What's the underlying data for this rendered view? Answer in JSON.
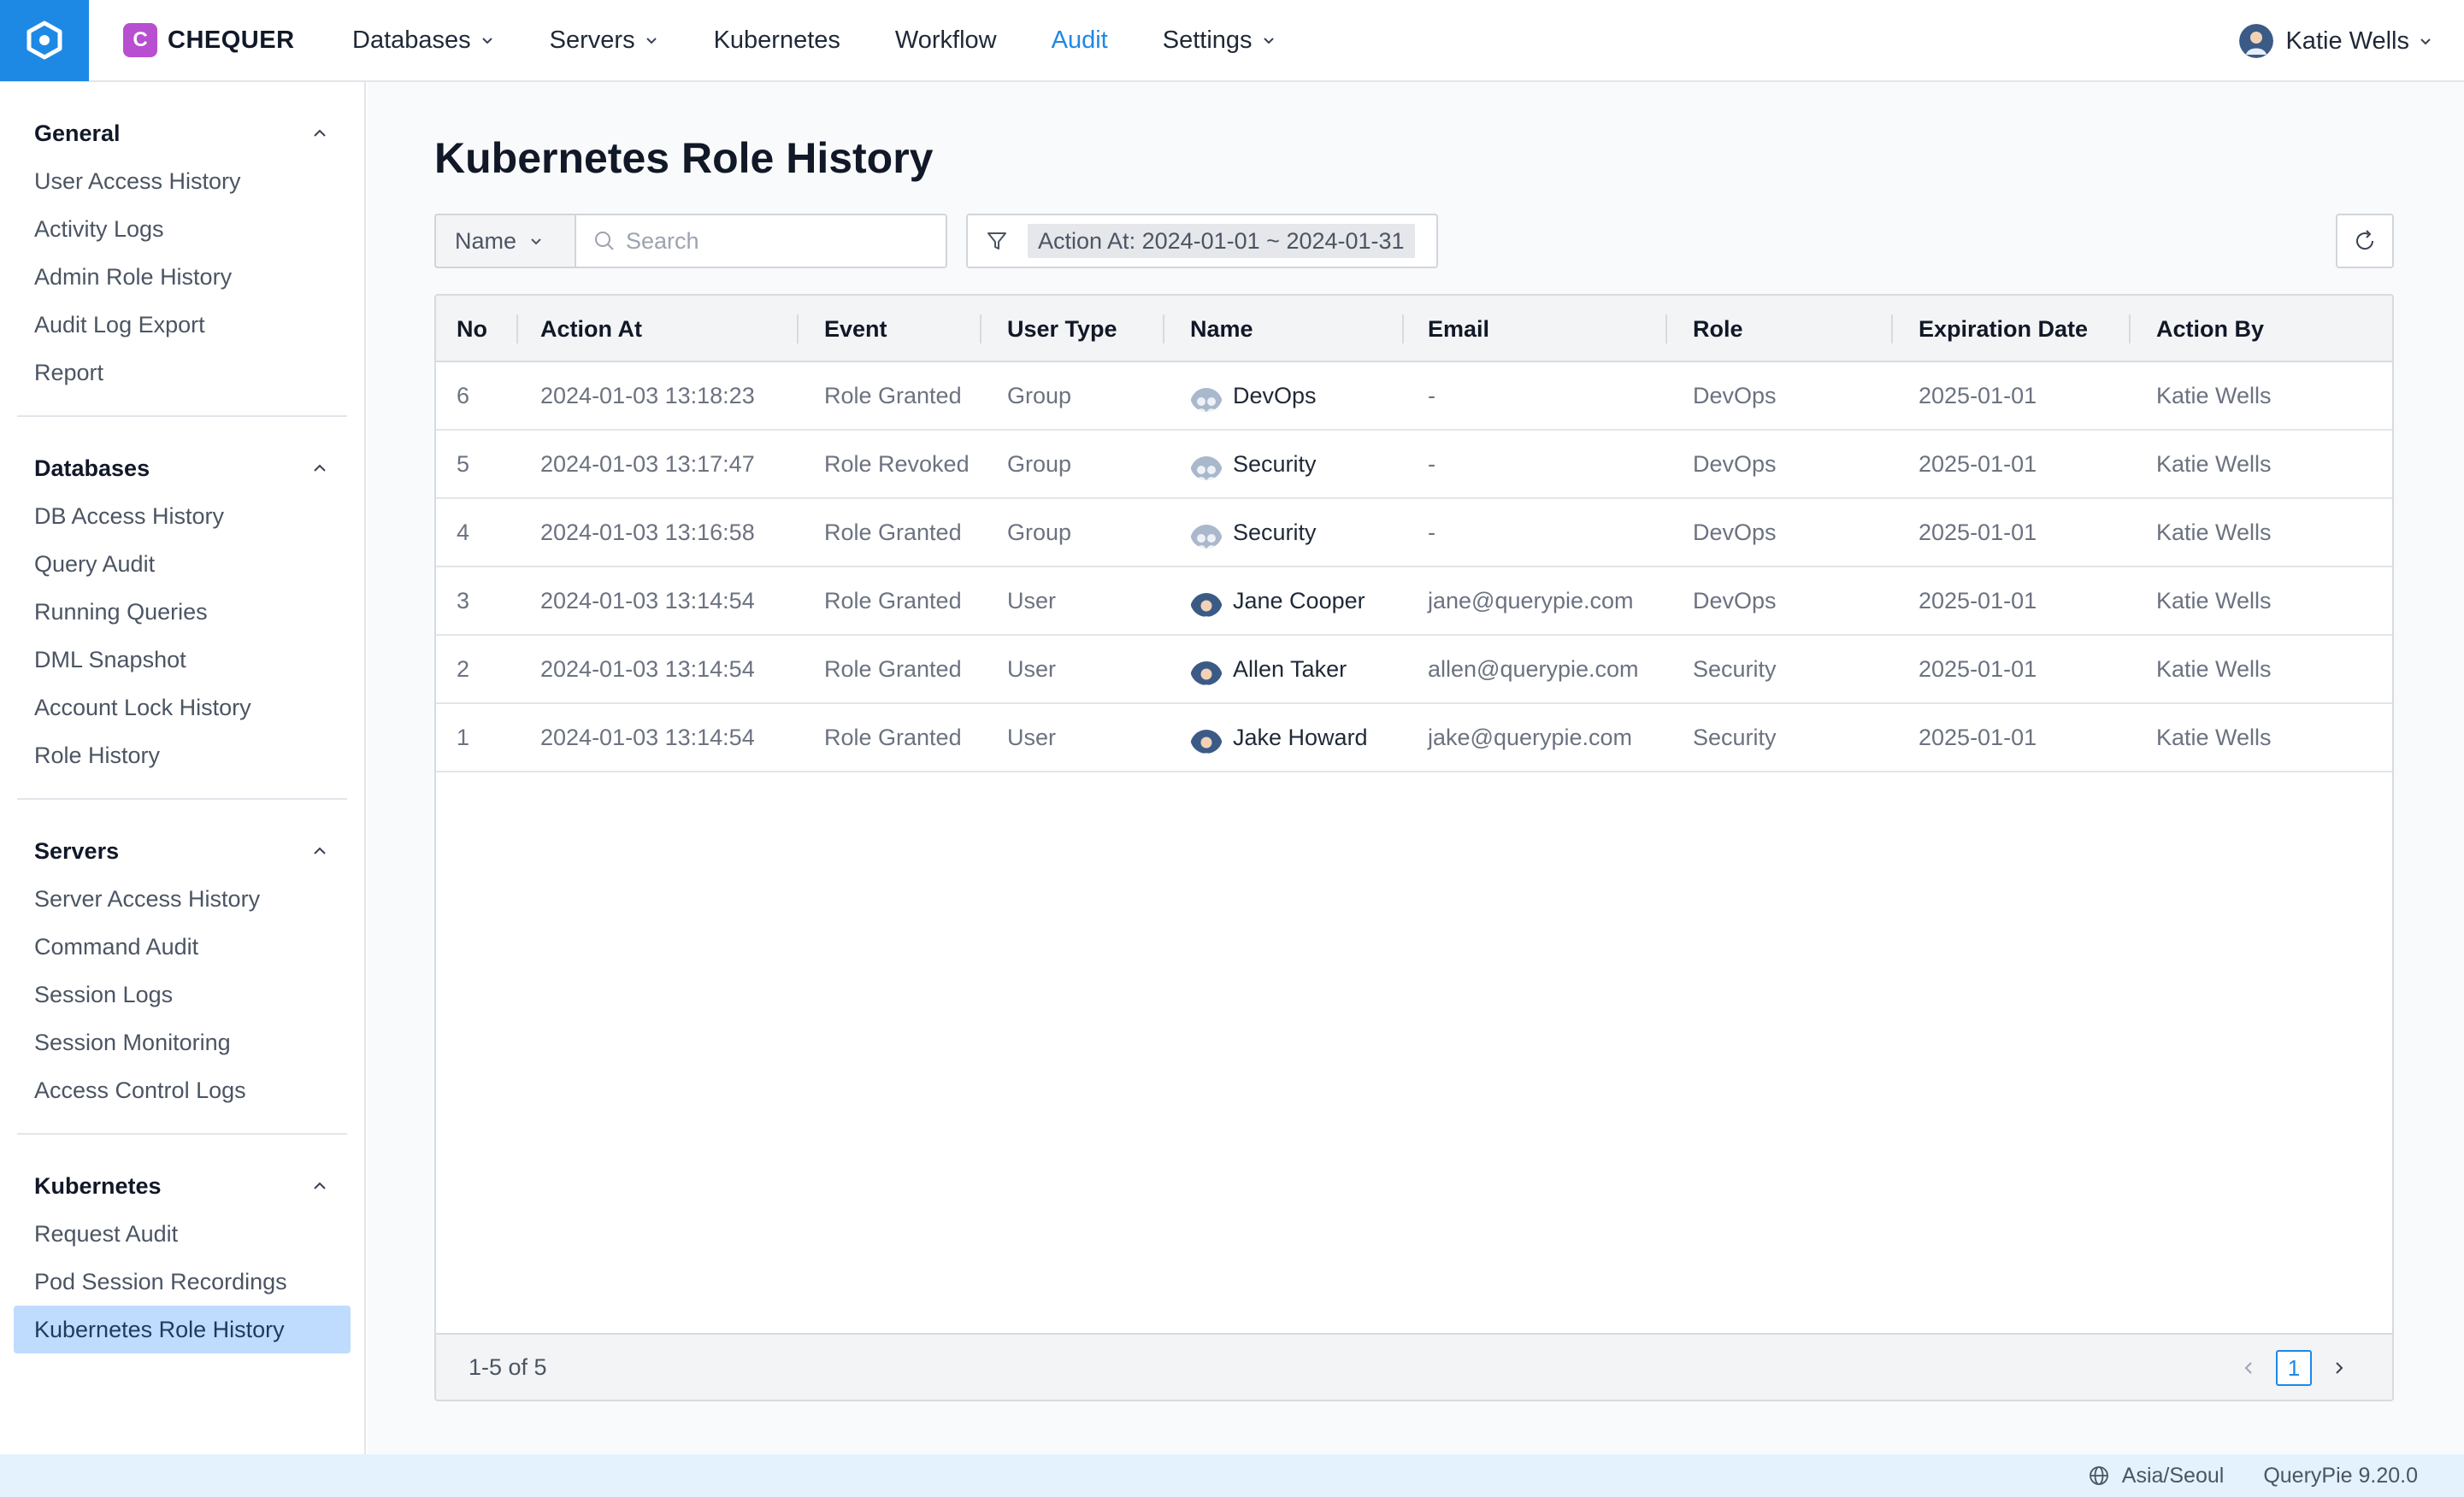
{
  "app": {
    "brand_letter": "C",
    "brand_name": "CHEQUER",
    "brand_color": "#b84fd0",
    "accent_color": "#1e88e5"
  },
  "nav": {
    "items": [
      {
        "label": "Databases",
        "has_dropdown": true,
        "active": false
      },
      {
        "label": "Servers",
        "has_dropdown": true,
        "active": false
      },
      {
        "label": "Kubernetes",
        "has_dropdown": false,
        "active": false
      },
      {
        "label": "Workflow",
        "has_dropdown": false,
        "active": false
      },
      {
        "label": "Audit",
        "has_dropdown": false,
        "active": true
      },
      {
        "label": "Settings",
        "has_dropdown": true,
        "active": false
      }
    ],
    "user_name": "Katie Wells"
  },
  "sidebar": {
    "sections": [
      {
        "title": "General",
        "items": [
          "User Access History",
          "Activity Logs",
          "Admin Role History",
          "Audit Log Export",
          "Report"
        ]
      },
      {
        "title": "Databases",
        "items": [
          "DB Access History",
          "Query Audit",
          "Running Queries",
          "DML Snapshot",
          "Account Lock History",
          "Role History"
        ]
      },
      {
        "title": "Servers",
        "items": [
          "Server Access History",
          "Command Audit",
          "Session Logs",
          "Session Monitoring",
          "Access Control Logs"
        ]
      },
      {
        "title": "Kubernetes",
        "items": [
          "Request Audit",
          "Pod Session Recordings",
          "Kubernetes Role History"
        ]
      }
    ],
    "active_item": "Kubernetes Role History"
  },
  "main": {
    "title": "Kubernetes Role History",
    "search_field": "Name",
    "search_placeholder": "Search",
    "filter_label": "Action At: 2024-01-01 ~ 2024-01-31"
  },
  "table": {
    "columns": [
      "No",
      "Action At",
      "Event",
      "User Type",
      "Name",
      "Email",
      "Role",
      "Expiration Date",
      "Action By"
    ],
    "rows": [
      {
        "no": "6",
        "action_at": "2024-01-03 13:18:23",
        "event": "Role Granted",
        "user_type": "Group",
        "name": "DevOps",
        "email": "-",
        "role": "DevOps",
        "expiration": "2025-01-01",
        "action_by": "Katie Wells"
      },
      {
        "no": "5",
        "action_at": "2024-01-03 13:17:47",
        "event": "Role Revoked",
        "user_type": "Group",
        "name": "Security",
        "email": "-",
        "role": "DevOps",
        "expiration": "2025-01-01",
        "action_by": "Katie Wells"
      },
      {
        "no": "4",
        "action_at": "2024-01-03 13:16:58",
        "event": "Role Granted",
        "user_type": "Group",
        "name": "Security",
        "email": "-",
        "role": "DevOps",
        "expiration": "2025-01-01",
        "action_by": "Katie Wells"
      },
      {
        "no": "3",
        "action_at": "2024-01-03 13:14:54",
        "event": "Role Granted",
        "user_type": "User",
        "name": "Jane Cooper",
        "email": "jane@querypie.com",
        "role": "DevOps",
        "expiration": "2025-01-01",
        "action_by": "Katie Wells"
      },
      {
        "no": "2",
        "action_at": "2024-01-03 13:14:54",
        "event": "Role Granted",
        "user_type": "User",
        "name": "Allen Taker",
        "email": "allen@querypie.com",
        "role": "Security",
        "expiration": "2025-01-01",
        "action_by": "Katie Wells"
      },
      {
        "no": "1",
        "action_at": "2024-01-03 13:14:54",
        "event": "Role Granted",
        "user_type": "User",
        "name": "Jake Howard",
        "email": "jake@querypie.com",
        "role": "Security",
        "expiration": "2025-01-01",
        "action_by": "Katie Wells"
      }
    ],
    "range_text": "1-5 of 5",
    "current_page": "1"
  },
  "status": {
    "timezone": "Asia/Seoul",
    "version": "QueryPie 9.20.0"
  }
}
